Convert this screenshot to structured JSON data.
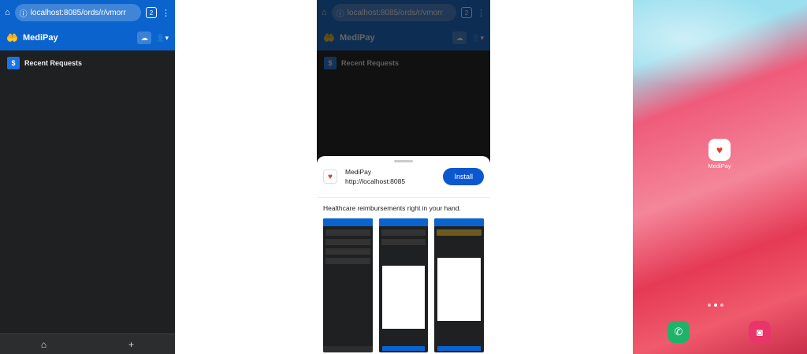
{
  "panel1": {
    "url": "localhost:8085/ords/r/vmorr",
    "tab_count": "2",
    "app_name": "MediPay",
    "nav_item": "Recent Requests",
    "nav_icon_glyph": "$",
    "bottom_icons": [
      "home-icon",
      "plus-icon"
    ]
  },
  "panel2": {
    "url": "localhost:8085/ords/r/vmorr",
    "tab_count": "2",
    "app_name": "MediPay",
    "nav_item": "Recent Requests",
    "install_app_name": "MediPay",
    "install_url": "http://localhost:8085",
    "install_button": "Install",
    "description": "Healthcare reimbursements right in your hand."
  },
  "panel3": {
    "home_app_label": "MediPay"
  },
  "colors": {
    "brand_blue": "#0b63ce",
    "install_blue": "#0b57d0",
    "dark_bg": "#1f2021"
  }
}
